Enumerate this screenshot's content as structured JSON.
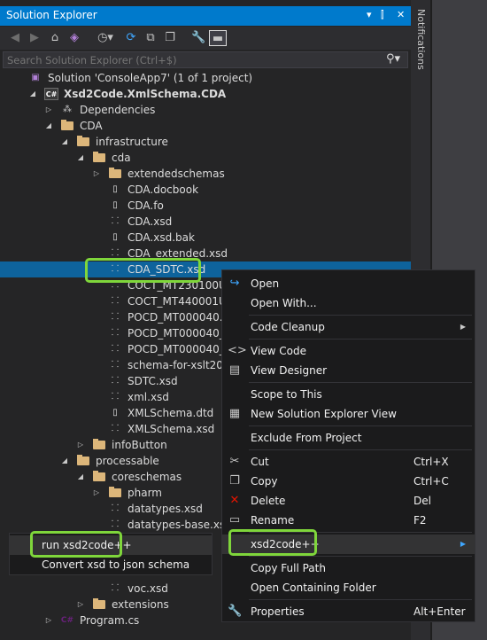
{
  "panel": {
    "title": "Solution Explorer",
    "controls": [
      "▾",
      "⫿",
      "✕"
    ]
  },
  "toolbar": {
    "icons": [
      "back-icon",
      "forward-icon",
      "home-icon",
      "vs-icon",
      "history-icon",
      "sync-icon",
      "collapse-icon",
      "copy-icon",
      "wrench-icon",
      "preview-icon"
    ]
  },
  "search": {
    "placeholder": "Search Solution Explorer (Ctrl+$)"
  },
  "side": {
    "notifications": "Notifications"
  },
  "tree": [
    {
      "label": "Solution 'ConsoleApp7' (1 of 1 project)",
      "depth": 0,
      "twisty": "",
      "icon": "solution-icon",
      "bold": false
    },
    {
      "label": "Xsd2Code.XmlSchema.CDA",
      "depth": 1,
      "twisty": "open",
      "icon": "csproj-icon",
      "bold": true
    },
    {
      "label": "Dependencies",
      "depth": 2,
      "twisty": "closed",
      "icon": "dependencies-icon",
      "bold": false
    },
    {
      "label": "CDA",
      "depth": 2,
      "twisty": "open",
      "icon": "folder-icon",
      "bold": false
    },
    {
      "label": "infrastructure",
      "depth": 3,
      "twisty": "open",
      "icon": "folder-icon",
      "bold": false
    },
    {
      "label": "cda",
      "depth": 4,
      "twisty": "open",
      "icon": "folder-icon",
      "bold": false
    },
    {
      "label": "extendedschemas",
      "depth": 5,
      "twisty": "closed",
      "icon": "folder-icon",
      "bold": false
    },
    {
      "label": "CDA.docbook",
      "depth": 5,
      "twisty": "",
      "icon": "file-icon",
      "bold": false
    },
    {
      "label": "CDA.fo",
      "depth": 5,
      "twisty": "",
      "icon": "file-icon",
      "bold": false
    },
    {
      "label": "CDA.xsd",
      "depth": 5,
      "twisty": "",
      "icon": "xsd-icon",
      "bold": false
    },
    {
      "label": "CDA.xsd.bak",
      "depth": 5,
      "twisty": "",
      "icon": "file-icon",
      "bold": false
    },
    {
      "label": "CDA_extended.xsd",
      "depth": 5,
      "twisty": "",
      "icon": "xsd-icon",
      "bold": false
    },
    {
      "label": "CDA_SDTC.xsd",
      "depth": 5,
      "twisty": "",
      "icon": "xsd-icon",
      "bold": false,
      "selected": true
    },
    {
      "label": "COCT_MT230100UV.xsd",
      "depth": 5,
      "twisty": "",
      "icon": "xsd-icon",
      "bold": false
    },
    {
      "label": "COCT_MT440001UV.xsd",
      "depth": 5,
      "twisty": "",
      "icon": "xsd-icon",
      "bold": false
    },
    {
      "label": "POCD_MT000040.xsd",
      "depth": 5,
      "twisty": "",
      "icon": "xsd-icon",
      "bold": false
    },
    {
      "label": "POCD_MT000040_ext_i",
      "depth": 5,
      "twisty": "",
      "icon": "xsd-icon",
      "bold": false
    },
    {
      "label": "POCD_MT000040_SDTC",
      "depth": 5,
      "twisty": "",
      "icon": "xsd-icon",
      "bold": false
    },
    {
      "label": "schema-for-xslt20.xsd",
      "depth": 5,
      "twisty": "",
      "icon": "xsd-icon",
      "bold": false
    },
    {
      "label": "SDTC.xsd",
      "depth": 5,
      "twisty": "",
      "icon": "xsd-icon",
      "bold": false
    },
    {
      "label": "xml.xsd",
      "depth": 5,
      "twisty": "",
      "icon": "xsd-icon",
      "bold": false
    },
    {
      "label": "XMLSchema.dtd",
      "depth": 5,
      "twisty": "",
      "icon": "file-icon",
      "bold": false
    },
    {
      "label": "XMLSchema.xsd",
      "depth": 5,
      "twisty": "",
      "icon": "xsd-icon",
      "bold": false
    },
    {
      "label": "infoButton",
      "depth": 4,
      "twisty": "closed",
      "icon": "folder-icon",
      "bold": false
    },
    {
      "label": "processable",
      "depth": 3,
      "twisty": "open",
      "icon": "folder-icon",
      "bold": false
    },
    {
      "label": "coreschemas",
      "depth": 4,
      "twisty": "open",
      "icon": "folder-icon",
      "bold": false
    },
    {
      "label": "pharm",
      "depth": 5,
      "twisty": "closed",
      "icon": "folder-icon",
      "bold": false
    },
    {
      "label": "datatypes.xsd",
      "depth": 5,
      "twisty": "",
      "icon": "xsd-icon",
      "bold": false
    },
    {
      "label": "datatypes-base.xsd",
      "depth": 5,
      "twisty": "",
      "icon": "xsd-icon",
      "bold": false
    },
    {
      "label": "",
      "depth": 5,
      "twisty": "",
      "icon": "xsd-icon",
      "bold": false
    },
    {
      "label": "",
      "depth": 5,
      "twisty": "",
      "icon": "xsd-icon",
      "bold": false
    },
    {
      "label": "",
      "depth": 5,
      "twisty": "",
      "icon": "xsd-icon",
      "bold": false
    },
    {
      "label": "voc.xsd",
      "depth": 5,
      "twisty": "",
      "icon": "xsd-icon",
      "bold": false
    },
    {
      "label": "extensions",
      "depth": 4,
      "twisty": "closed",
      "icon": "folder-icon",
      "bold": false
    },
    {
      "label": "Program.cs",
      "depth": 2,
      "twisty": "closed",
      "icon": "csharp-icon",
      "bold": false
    }
  ],
  "context_menu": {
    "items": [
      {
        "label": "Open",
        "shortcut": "",
        "icon": "open-icon",
        "submenu": false
      },
      {
        "label": "Open With...",
        "shortcut": "",
        "icon": "",
        "submenu": false
      },
      {
        "sep": true
      },
      {
        "label": "Code Cleanup",
        "shortcut": "",
        "icon": "",
        "submenu": true
      },
      {
        "sep": true
      },
      {
        "label": "View Code",
        "shortcut": "",
        "icon": "code-icon",
        "submenu": false
      },
      {
        "label": "View Designer",
        "shortcut": "",
        "icon": "designer-icon",
        "submenu": false
      },
      {
        "sep": true
      },
      {
        "label": "Scope to This",
        "shortcut": "",
        "icon": "",
        "submenu": false
      },
      {
        "label": "New Solution Explorer View",
        "shortcut": "",
        "icon": "new-view-icon",
        "submenu": false
      },
      {
        "sep": true
      },
      {
        "label": "Exclude From Project",
        "shortcut": "",
        "icon": "",
        "submenu": false
      },
      {
        "sep": true
      },
      {
        "label": "Cut",
        "shortcut": "Ctrl+X",
        "icon": "cut-icon",
        "submenu": false
      },
      {
        "label": "Copy",
        "shortcut": "Ctrl+C",
        "icon": "copy-icon",
        "submenu": false
      },
      {
        "label": "Delete",
        "shortcut": "Del",
        "icon": "delete-icon",
        "submenu": false
      },
      {
        "label": "Rename",
        "shortcut": "F2",
        "icon": "rename-icon",
        "submenu": false
      },
      {
        "sep": true
      },
      {
        "label": "xsd2code++",
        "shortcut": "",
        "icon": "",
        "submenu": true,
        "hover": true
      },
      {
        "sep": true
      },
      {
        "label": "Copy Full Path",
        "shortcut": "",
        "icon": "",
        "submenu": false
      },
      {
        "label": "Open Containing Folder",
        "shortcut": "",
        "icon": "",
        "submenu": false
      },
      {
        "sep": true
      },
      {
        "label": "Properties",
        "shortcut": "Alt+Enter",
        "icon": "wrench-icon",
        "submenu": false
      }
    ]
  },
  "submenu": {
    "items": [
      {
        "label": "run xsd2code++",
        "hover": true
      },
      {
        "label": "Convert xsd to json schema",
        "hover": false
      }
    ]
  },
  "colors": {
    "accent": "#007acc",
    "selection": "#0e639c",
    "highlight": "#7fd63b",
    "folder": "#dcb67a"
  }
}
